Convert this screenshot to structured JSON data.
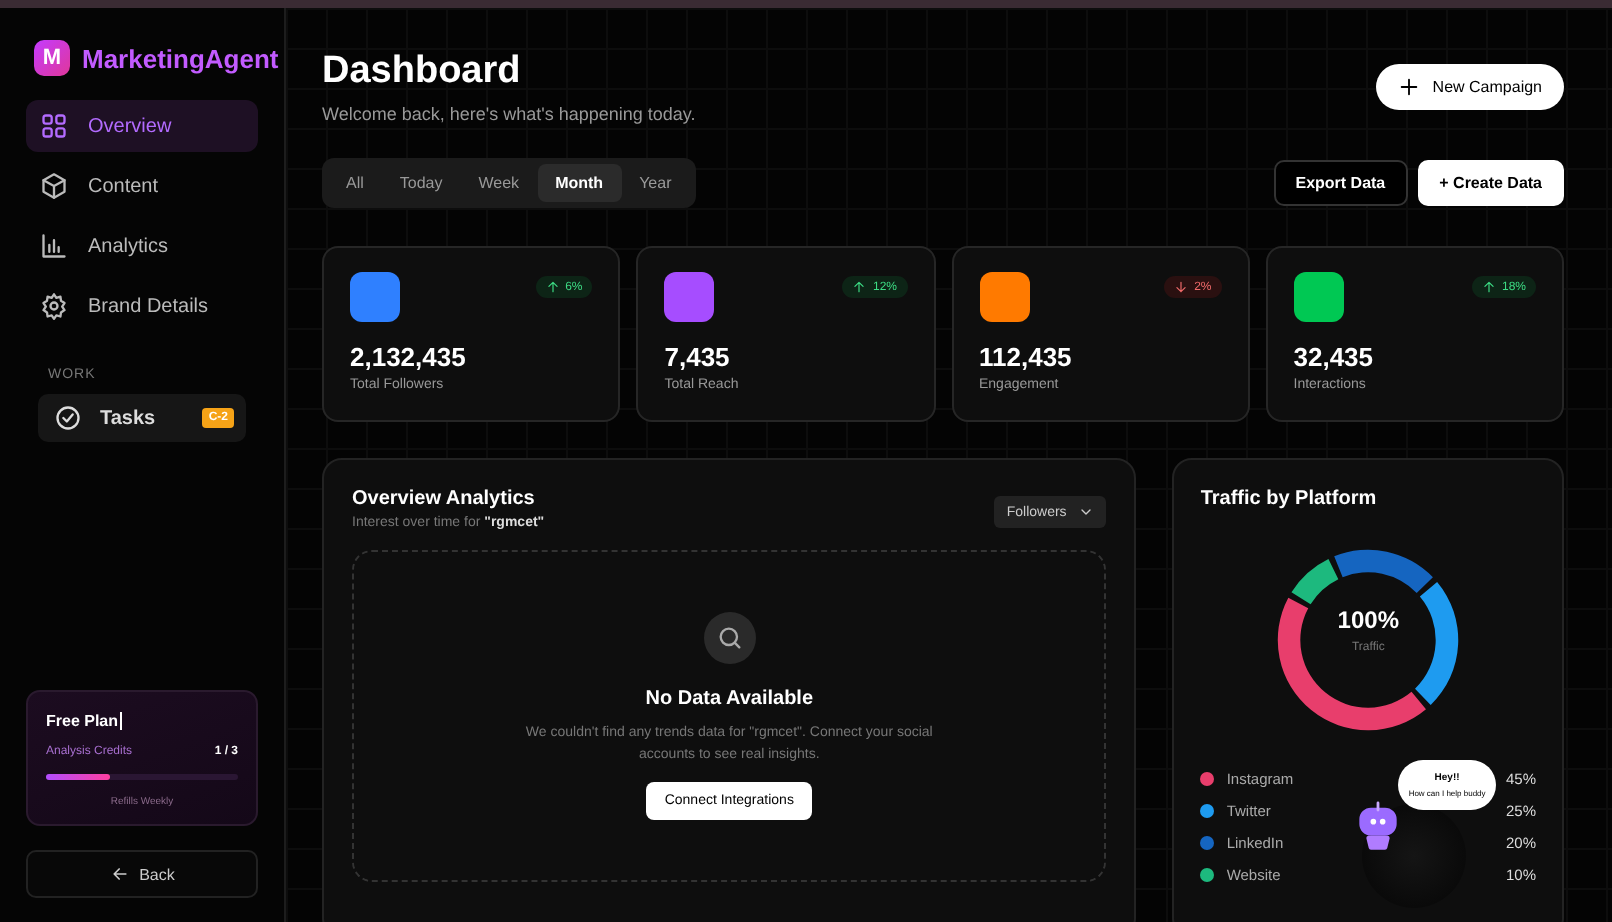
{
  "brand": {
    "initial": "M",
    "name": "MarketingAgent"
  },
  "nav": [
    {
      "label": "Overview",
      "selected": true
    },
    {
      "label": "Content",
      "selected": false
    },
    {
      "label": "Analytics",
      "selected": false
    },
    {
      "label": "Brand Details",
      "selected": false
    }
  ],
  "work": {
    "heading": "WORK",
    "items": [
      {
        "label": "Tasks",
        "badge": "C-2",
        "selected": false
      }
    ]
  },
  "plan": {
    "title": "Free Plan",
    "credits_label": "Analysis Credits",
    "credits_value": "1 / 3",
    "level": 0.33,
    "note": "Refills Weekly"
  },
  "back_button": "Back",
  "header": {
    "title": "Dashboard",
    "subtitle": "Welcome back, here's what's happening today.",
    "new_campaign": "New Campaign"
  },
  "periods": [
    {
      "label": "All",
      "selected": false
    },
    {
      "label": "Today",
      "selected": false
    },
    {
      "label": "Week",
      "selected": false
    },
    {
      "label": "Month",
      "selected": true
    },
    {
      "label": "Year",
      "selected": false
    }
  ],
  "actions": [
    {
      "label": "Export Data",
      "kind": "outline"
    },
    {
      "label": "+ Create Data",
      "kind": "solid"
    }
  ],
  "stats": [
    {
      "value": "2,132,435",
      "label": "Total Followers",
      "change": "6%",
      "kind": "up",
      "color": "#2f80ff"
    },
    {
      "value": "7,435",
      "label": "Total Reach",
      "change": "12%",
      "kind": "up",
      "color": "#a64dff"
    },
    {
      "value": "112,435",
      "label": "Engagement",
      "change": "2%",
      "kind": "down",
      "color": "#ff7a00"
    },
    {
      "value": "32,435",
      "label": "Interactions",
      "change": "18%",
      "kind": "up",
      "color": "#00c853"
    }
  ],
  "overview": {
    "title": "Overview Analytics",
    "subtitle": "Interest over time for **\"rgmcet\"**",
    "metric": "Followers",
    "empty_title": "No Data Available",
    "empty_text": "We couldn't find any trends data for \"rgmcet\". Connect your social accounts to see real insights.",
    "connect_button": "Connect Integrations"
  },
  "traffic": {
    "title": "Traffic by Platform",
    "center_value": "100%",
    "center_label": "Traffic",
    "chart_data": {
      "type": "donut",
      "categories": [
        "Instagram",
        "Twitter",
        "LinkedIn",
        "Website"
      ],
      "values": [
        45,
        25,
        20,
        10
      ]
    },
    "legend": [
      {
        "value": "45%",
        "color": "#e83e6c"
      },
      {
        "value": "25%",
        "color": "#1e9bf0"
      },
      {
        "value": "20%",
        "color": "#1565c0"
      },
      {
        "value": "10%",
        "color": "#1db97e"
      }
    ]
  },
  "assistant": {
    "greeting": "Hey!!",
    "prompt": "How can I help buddy"
  }
}
